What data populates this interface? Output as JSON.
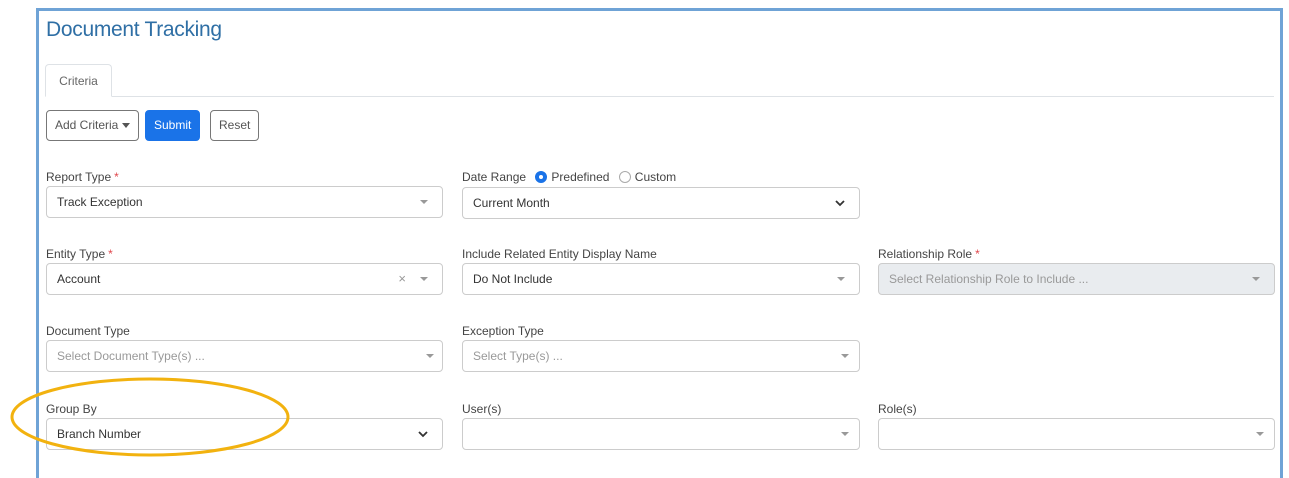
{
  "page": {
    "title": "Document Tracking"
  },
  "tabs": [
    {
      "label": "Criteria"
    }
  ],
  "toolbar": {
    "add_criteria": "Add Criteria",
    "submit": "Submit",
    "reset": "Reset"
  },
  "fields": {
    "report_type": {
      "label": "Report Type",
      "required": "*",
      "value": "Track Exception"
    },
    "date_range": {
      "label": "Date Range",
      "option_predefined": "Predefined",
      "option_custom": "Custom",
      "selected": "Predefined",
      "value": "Current Month"
    },
    "entity_type": {
      "label": "Entity Type",
      "required": "*",
      "value": "Account",
      "clear": "×"
    },
    "related_entity": {
      "label": "Include Related Entity Display Name",
      "value": "Do Not Include"
    },
    "relationship_role": {
      "label": "Relationship Role",
      "required": "*",
      "placeholder": "Select Relationship Role to Include ..."
    },
    "document_type": {
      "label": "Document Type",
      "placeholder": "Select Document Type(s) ..."
    },
    "exception_type": {
      "label": "Exception Type",
      "placeholder": "Select Type(s) ..."
    },
    "group_by": {
      "label": "Group By",
      "value": "Branch Number"
    },
    "users": {
      "label": "User(s)",
      "value": ""
    },
    "roles": {
      "label": "Role(s)",
      "value": ""
    }
  },
  "annotation": {
    "color": "#f2b20f"
  }
}
